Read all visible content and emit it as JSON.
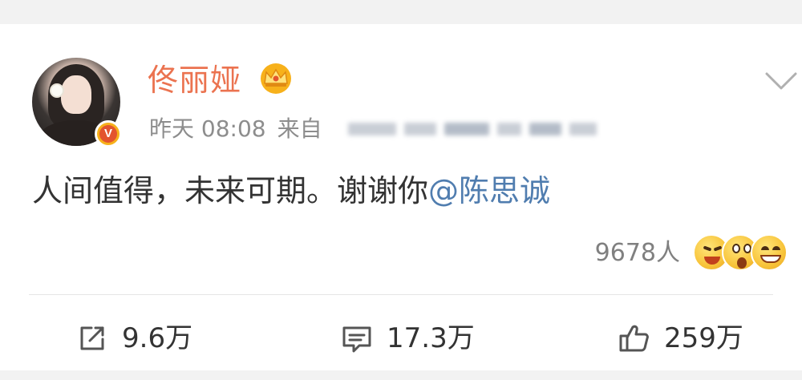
{
  "post": {
    "author": {
      "name": "佟丽娅",
      "avatar_icon": "avatar",
      "badge_icon": "verified-v-icon",
      "badge_letter": "V",
      "crown_icon": "crown-icon"
    },
    "meta": {
      "time": "昨天 08:08",
      "source_prefix": "来自"
    },
    "content": {
      "text": "人间值得，未来可期。谢谢你",
      "mention": "@陈思诚"
    },
    "reactions": {
      "count_label": "9678人",
      "emoji_icons": [
        "laugh-cry-emoji-icon",
        "shocked-emoji-icon",
        "grin-emoji-icon"
      ]
    },
    "actions": {
      "repost": {
        "label": "9.6万",
        "icon": "repost-icon"
      },
      "comment": {
        "label": "17.3万",
        "icon": "comment-icon"
      },
      "like": {
        "label": "259万",
        "icon": "thumbs-up-icon"
      }
    }
  },
  "colors": {
    "username": "#eb7350",
    "mention": "#507daf",
    "meta": "#8d8d8d",
    "background": "#f2f2f2",
    "card": "#ffffff"
  }
}
